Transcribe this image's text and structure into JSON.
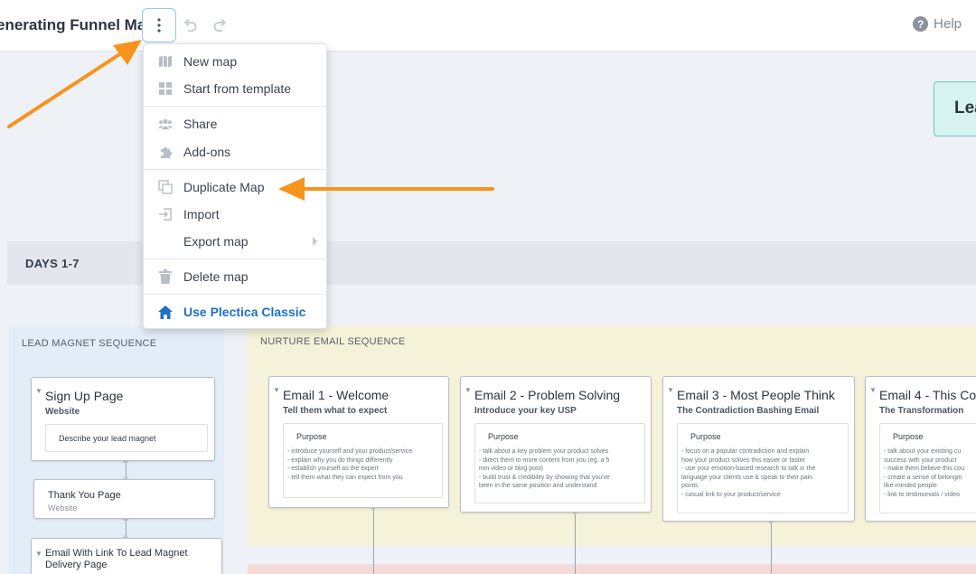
{
  "header": {
    "title": "enerating Funnel Map",
    "help_label": "Help"
  },
  "menu": {
    "items": [
      {
        "label": "New map",
        "icon": "map-icon"
      },
      {
        "label": "Start from template",
        "icon": "template-grid-icon"
      },
      {
        "label": "Share",
        "icon": "users-icon"
      },
      {
        "label": "Add-ons",
        "icon": "puzzle-icon"
      },
      {
        "label": "Duplicate Map",
        "icon": "duplicate-icon"
      },
      {
        "label": "Import",
        "icon": "import-icon"
      },
      {
        "label": "Export map",
        "icon": "submenu-arrow-icon"
      },
      {
        "label": "Delete map",
        "icon": "trash-icon"
      },
      {
        "label": "Use Plectica Classic",
        "icon": "home-icon"
      }
    ]
  },
  "canvas": {
    "lead_box": "Lea",
    "days_label": "DAYS 1-7",
    "lanes": {
      "lead_magnet": "LEAD MAGNET SEQUENCE",
      "nurture": "NURTURE EMAIL SEQUENCE"
    },
    "lead_cards": [
      {
        "title": "Sign Up Page",
        "subtitle": "Website",
        "inner": "Describe your lead magnet"
      },
      {
        "title": "Thank You Page",
        "subtitle": "Website"
      },
      {
        "title": "Email With Link To Lead Magnet Delivery Page"
      }
    ],
    "email_cards": [
      {
        "title": "Email 1 - Welcome",
        "subtitle": "Tell them what to expect",
        "purpose": "Purpose",
        "lines": [
          "- introduce yourself and your product/service",
          "- explain why you do things differently",
          "- establish yourself as the expert",
          "- tell them what they can expect from you"
        ]
      },
      {
        "title": "Email 2 - Problem Solving",
        "subtitle": "Introduce your key USP",
        "purpose": "Purpose",
        "lines": [
          "- talk about a key problem your product solves",
          "- direct them to more content from you (eg. a 5",
          "min video or blog post)",
          "- build trust & credibility by showing that you've",
          "been in the same position and understand"
        ]
      },
      {
        "title": "Email 3 - Most People Think",
        "subtitle": "The Contradiction Bashing Email",
        "purpose": "Purpose",
        "lines": [
          "- focus on a popular contradiction and explain",
          "how your product solves this easier or faster",
          "- use your emotion-based research to talk in the",
          "language your clients use & speak to their pain",
          "points",
          "- casual link to your product/service"
        ]
      },
      {
        "title": "Email 4 - This Cou",
        "subtitle": "The Transformation",
        "purpose": "Purpose",
        "lines": [
          "- talk about your existing cu",
          "success with your product",
          "- make them believe this cou",
          "- create a sense of belongin",
          "like-minded people",
          "- link to testimonials / video"
        ]
      }
    ]
  },
  "colors": {
    "accent_orange": "#f7941d",
    "link_blue": "#1f6fc5",
    "lead_box_bg": "#d6f3f0",
    "nurture_lane": "#f4f2d8",
    "lead_lane": "#e3edf8"
  }
}
